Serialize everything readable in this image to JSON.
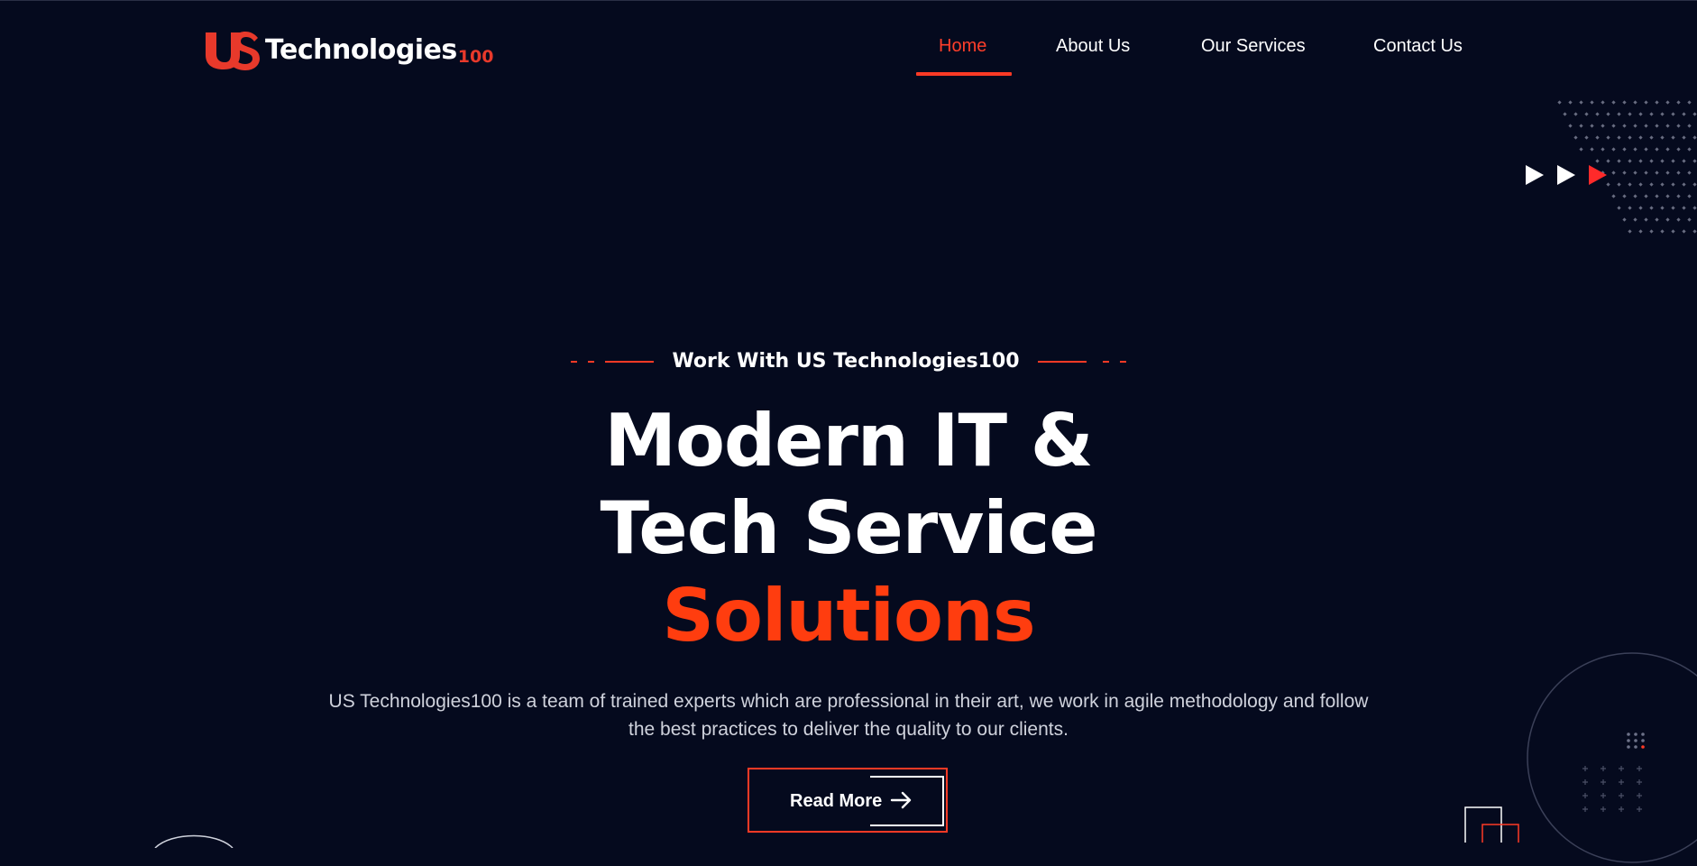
{
  "header": {
    "logo": {
      "mark": "US",
      "name": "Technologies",
      "suffix": "100"
    },
    "nav": [
      {
        "label": "Home",
        "active": true
      },
      {
        "label": "About Us",
        "active": false
      },
      {
        "label": "Our Services",
        "active": false
      },
      {
        "label": "Contact Us",
        "active": false
      }
    ]
  },
  "hero": {
    "eyebrow": "Work With US Technologies100",
    "headline_line1": "Modern IT &",
    "headline_line2": "Tech Service",
    "headline_accent": "Solutions",
    "description_line1": "US Technologies100 is a team of trained experts which are professional in their art, we work in agile methodology and follow",
    "description_line2": "the best practices to deliver the quality to our clients.",
    "cta_label": "Read More"
  },
  "colors": {
    "background": "#050a1e",
    "accent": "#ff3a25",
    "accent_headline": "#ff3d0f",
    "text": "#ffffff",
    "muted_text": "#cfd2dc"
  },
  "icons": {
    "cta": "arrow-right-icon",
    "decoration": [
      "play-triangles-icon",
      "dot-pattern",
      "outline-circle",
      "plus-grid",
      "outline-squares"
    ]
  }
}
